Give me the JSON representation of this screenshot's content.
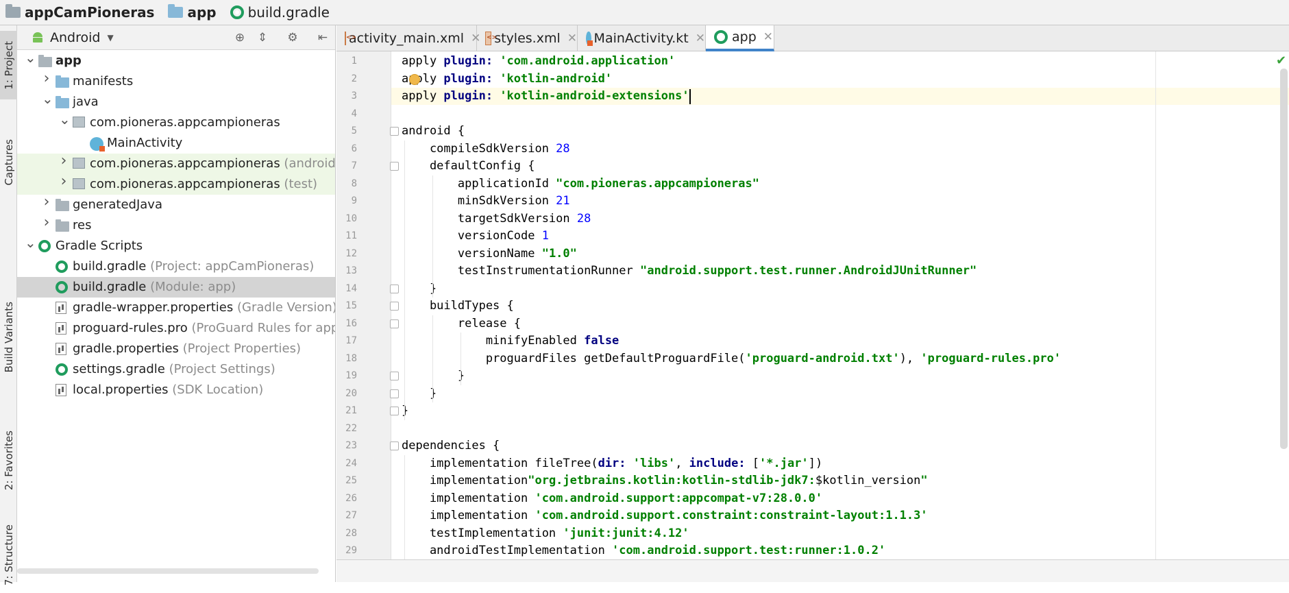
{
  "breadcrumb": [
    {
      "label": "appCamPioneras",
      "icon": "folder-icon"
    },
    {
      "label": "app",
      "icon": "folder-icon"
    },
    {
      "label": "build.gradle",
      "icon": "gradle-icon"
    }
  ],
  "left_strip": {
    "project": "1: Project",
    "captures": "Captures",
    "build_variants": "Build Variants",
    "favorites": "2: Favorites",
    "structure": "7: Structure"
  },
  "project_panel": {
    "view_mode": "Android",
    "tree": [
      {
        "label": "app",
        "suffix": "",
        "level": 0,
        "arrow": "down",
        "icon": "module",
        "bold": true
      },
      {
        "label": "manifests",
        "suffix": "",
        "level": 1,
        "arrow": "right",
        "icon": "folder"
      },
      {
        "label": "java",
        "suffix": "",
        "level": 1,
        "arrow": "down",
        "icon": "folder"
      },
      {
        "label": "com.pioneras.appcampioneras",
        "suffix": "",
        "level": 2,
        "arrow": "down",
        "icon": "package"
      },
      {
        "label": "MainActivity",
        "suffix": "",
        "level": 3,
        "arrow": "",
        "icon": "kotlin"
      },
      {
        "label": "com.pioneras.appcampioneras",
        "suffix": "(androidTest)",
        "level": 2,
        "arrow": "right",
        "icon": "package",
        "tint": "green"
      },
      {
        "label": "com.pioneras.appcampioneras",
        "suffix": "(test)",
        "level": 2,
        "arrow": "right",
        "icon": "package",
        "tint": "green"
      },
      {
        "label": "generatedJava",
        "suffix": "",
        "level": 1,
        "arrow": "right",
        "icon": "folder-grey"
      },
      {
        "label": "res",
        "suffix": "",
        "level": 1,
        "arrow": "right",
        "icon": "folder-grey"
      },
      {
        "label": "Gradle Scripts",
        "suffix": "",
        "level": 0,
        "arrow": "down",
        "icon": "gradle"
      },
      {
        "label": "build.gradle",
        "suffix": "(Project: appCamPioneras)",
        "level": 1,
        "arrow": "",
        "icon": "gradle"
      },
      {
        "label": "build.gradle",
        "suffix": "(Module: app)",
        "level": 1,
        "arrow": "",
        "icon": "gradle",
        "selected": true
      },
      {
        "label": "gradle-wrapper.properties",
        "suffix": "(Gradle Version)",
        "level": 1,
        "arrow": "",
        "icon": "props"
      },
      {
        "label": "proguard-rules.pro",
        "suffix": "(ProGuard Rules for app)",
        "level": 1,
        "arrow": "",
        "icon": "props"
      },
      {
        "label": "gradle.properties",
        "suffix": "(Project Properties)",
        "level": 1,
        "arrow": "",
        "icon": "props"
      },
      {
        "label": "settings.gradle",
        "suffix": "(Project Settings)",
        "level": 1,
        "arrow": "",
        "icon": "gradle"
      },
      {
        "label": "local.properties",
        "suffix": "(SDK Location)",
        "level": 1,
        "arrow": "",
        "icon": "props"
      }
    ]
  },
  "tabs": [
    {
      "label": "activity_main.xml",
      "icon": "xml-icon",
      "active": false
    },
    {
      "label": "styles.xml",
      "icon": "xml-icon",
      "active": false
    },
    {
      "label": "MainActivity.kt",
      "icon": "kotlin-icon",
      "active": false
    },
    {
      "label": "app",
      "icon": "gradle-icon",
      "active": true
    }
  ],
  "colors": {
    "accent": "#4083c9",
    "keyword": "#000080",
    "string": "#008000",
    "number": "#0000ff",
    "selection": "#d4d4d4"
  },
  "code": [
    {
      "n": "1",
      "tokens": [
        [
          "t",
          "apply "
        ],
        [
          "kw",
          "plugin: "
        ],
        [
          "str",
          "'com.android.application'"
        ]
      ]
    },
    {
      "n": "2",
      "tokens": [
        [
          "t",
          "apply "
        ],
        [
          "kw",
          "plugin: "
        ],
        [
          "str",
          "'kotlin-android'"
        ]
      ]
    },
    {
      "n": "3",
      "tokens": [
        [
          "t",
          "apply "
        ],
        [
          "kw",
          "plugin: "
        ],
        [
          "str",
          "'kotlin-android-extensions'"
        ]
      ]
    },
    {
      "n": "4",
      "tokens": []
    },
    {
      "n": "5",
      "tokens": [
        [
          "t",
          "android {"
        ]
      ]
    },
    {
      "n": "6",
      "tokens": [
        [
          "t",
          "    compileSdkVersion "
        ],
        [
          "num",
          "28"
        ]
      ]
    },
    {
      "n": "7",
      "tokens": [
        [
          "t",
          "    defaultConfig {"
        ]
      ]
    },
    {
      "n": "8",
      "tokens": [
        [
          "t",
          "        applicationId "
        ],
        [
          "str",
          "\"com.pioneras.appcampioneras\""
        ]
      ]
    },
    {
      "n": "9",
      "tokens": [
        [
          "t",
          "        minSdkVersion "
        ],
        [
          "num",
          "21"
        ]
      ]
    },
    {
      "n": "10",
      "tokens": [
        [
          "t",
          "        targetSdkVersion "
        ],
        [
          "num",
          "28"
        ]
      ]
    },
    {
      "n": "11",
      "tokens": [
        [
          "t",
          "        versionCode "
        ],
        [
          "num",
          "1"
        ]
      ]
    },
    {
      "n": "12",
      "tokens": [
        [
          "t",
          "        versionName "
        ],
        [
          "str",
          "\"1.0\""
        ]
      ]
    },
    {
      "n": "13",
      "tokens": [
        [
          "t",
          "        testInstrumentationRunner "
        ],
        [
          "str",
          "\"android.support.test.runner.AndroidJUnitRunner\""
        ]
      ]
    },
    {
      "n": "14",
      "tokens": [
        [
          "t",
          "    }"
        ]
      ]
    },
    {
      "n": "15",
      "tokens": [
        [
          "t",
          "    buildTypes {"
        ]
      ]
    },
    {
      "n": "16",
      "tokens": [
        [
          "t",
          "        release {"
        ]
      ]
    },
    {
      "n": "17",
      "tokens": [
        [
          "t",
          "            minifyEnabled "
        ],
        [
          "kw",
          "false"
        ]
      ]
    },
    {
      "n": "18",
      "tokens": [
        [
          "t",
          "            proguardFiles getDefaultProguardFile("
        ],
        [
          "str",
          "'proguard-android.txt'"
        ],
        [
          "t",
          "), "
        ],
        [
          "str",
          "'proguard-rules.pro'"
        ]
      ]
    },
    {
      "n": "19",
      "tokens": [
        [
          "t",
          "        }"
        ]
      ]
    },
    {
      "n": "20",
      "tokens": [
        [
          "t",
          "    }"
        ]
      ]
    },
    {
      "n": "21",
      "tokens": [
        [
          "t",
          "}"
        ]
      ]
    },
    {
      "n": "22",
      "tokens": []
    },
    {
      "n": "23",
      "tokens": [
        [
          "t",
          "dependencies {"
        ]
      ]
    },
    {
      "n": "24",
      "tokens": [
        [
          "t",
          "    implementation fileTree("
        ],
        [
          "kw",
          "dir: "
        ],
        [
          "str",
          "'libs'"
        ],
        [
          "t",
          ", "
        ],
        [
          "kw",
          "include: "
        ],
        [
          "t",
          "["
        ],
        [
          "str",
          "'*.jar'"
        ],
        [
          "t",
          "])"
        ]
      ]
    },
    {
      "n": "25",
      "tokens": [
        [
          "t",
          "    implementation"
        ],
        [
          "str",
          "\"org.jetbrains.kotlin:kotlin-stdlib-jdk7:"
        ],
        [
          "t",
          "$kotlin_version"
        ],
        [
          "str",
          "\""
        ]
      ]
    },
    {
      "n": "26",
      "tokens": [
        [
          "t",
          "    implementation "
        ],
        [
          "str",
          "'com.android.support:appcompat-v7:28.0.0'"
        ]
      ]
    },
    {
      "n": "27",
      "tokens": [
        [
          "t",
          "    implementation "
        ],
        [
          "str",
          "'com.android.support.constraint:constraint-layout:1.1.3'"
        ]
      ]
    },
    {
      "n": "28",
      "tokens": [
        [
          "t",
          "    testImplementation "
        ],
        [
          "str",
          "'junit:junit:4.12'"
        ]
      ]
    },
    {
      "n": "29",
      "tokens": [
        [
          "t",
          "    androidTestImplementation "
        ],
        [
          "str",
          "'com.android.support.test:runner:1.0.2'"
        ]
      ]
    }
  ]
}
